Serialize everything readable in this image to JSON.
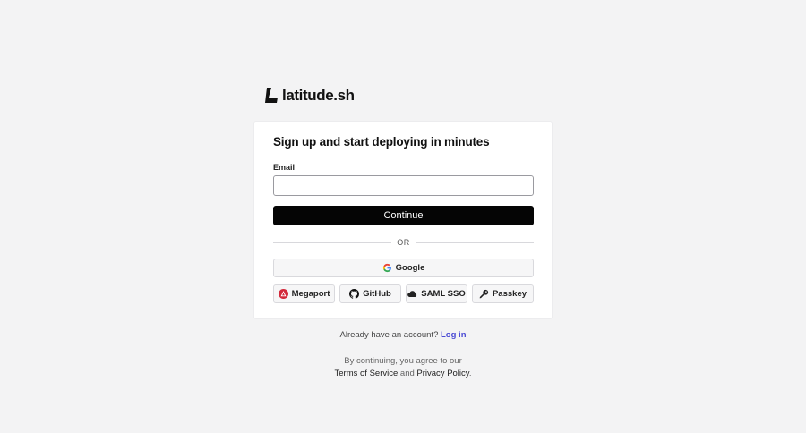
{
  "brand": {
    "name": "latitude.sh"
  },
  "signup": {
    "heading": "Sign up and start deploying in minutes",
    "email_label": "Email",
    "email_value": "",
    "email_placeholder": "",
    "continue_label": "Continue",
    "or_label": "OR"
  },
  "providers": {
    "google": {
      "label": "Google",
      "icon": "google-icon"
    },
    "megaport": {
      "label": "Megaport",
      "icon": "megaport-icon"
    },
    "github": {
      "label": "GitHub",
      "icon": "github-icon"
    },
    "saml": {
      "label": "SAML SSO",
      "icon": "cloud-icon"
    },
    "passkey": {
      "label": "Passkey",
      "icon": "key-icon"
    }
  },
  "footer": {
    "already_text": "Already have an account?",
    "login_label": "Log in",
    "agree_text": "By continuing, you agree to our",
    "terms_label": "Terms of Service",
    "and_text": "and",
    "privacy_label": "Privacy Policy",
    "period": "."
  },
  "colors": {
    "background": "#f3f3f4",
    "primary_button": "#050505",
    "link": "#4b4bd4",
    "megaport_red": "#d3293b"
  }
}
